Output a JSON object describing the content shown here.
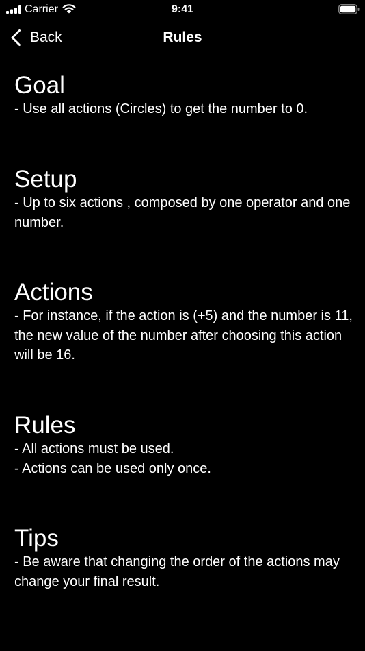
{
  "status_bar": {
    "carrier": "Carrier",
    "time": "9:41",
    "icons": [
      "signal-bars-icon",
      "wifi-icon",
      "battery-icon"
    ]
  },
  "nav": {
    "back_label": "Back",
    "back_icon": "chevron-left-icon",
    "title": "Rules"
  },
  "sections": [
    {
      "title": "Goal",
      "lines": [
        "- Use all actions (Circles) to get the number to 0."
      ]
    },
    {
      "title": "Setup",
      "lines": [
        "- Up to six actions , composed by one operator and one number."
      ]
    },
    {
      "title": "Actions",
      "lines": [
        "- For instance, if the action is (+5) and the number is 11, the new value of the number after choosing this action will be 16."
      ]
    },
    {
      "title": "Rules",
      "lines": [
        "- All actions must be used.",
        "- Actions can be used only once."
      ]
    },
    {
      "title": "Tips",
      "lines": [
        "- Be aware that changing the order of the actions may change your final result."
      ]
    }
  ],
  "colors": {
    "background": "#000000",
    "text": "#ffffff"
  }
}
